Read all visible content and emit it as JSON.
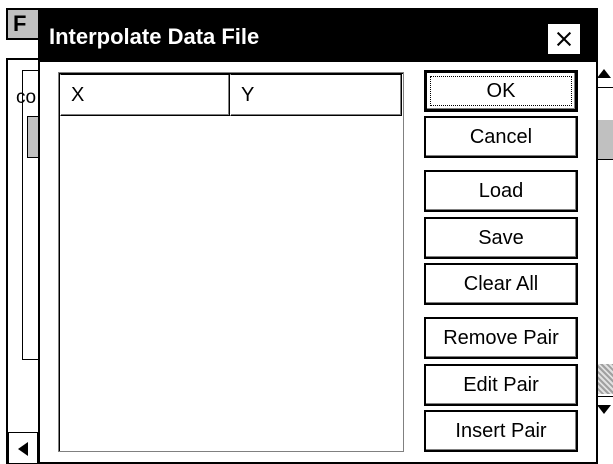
{
  "background_window": {
    "tab_label": "F",
    "partial_label": "co"
  },
  "dialog": {
    "title": "Interpolate Data File",
    "list": {
      "columns": [
        "X",
        "Y"
      ],
      "rows": []
    },
    "buttons": {
      "ok": "OK",
      "cancel": "Cancel",
      "load": "Load",
      "save": "Save",
      "clear_all": "Clear All",
      "remove_pair": "Remove Pair",
      "edit_pair": "Edit Pair",
      "insert_pair": "Insert Pair"
    }
  }
}
